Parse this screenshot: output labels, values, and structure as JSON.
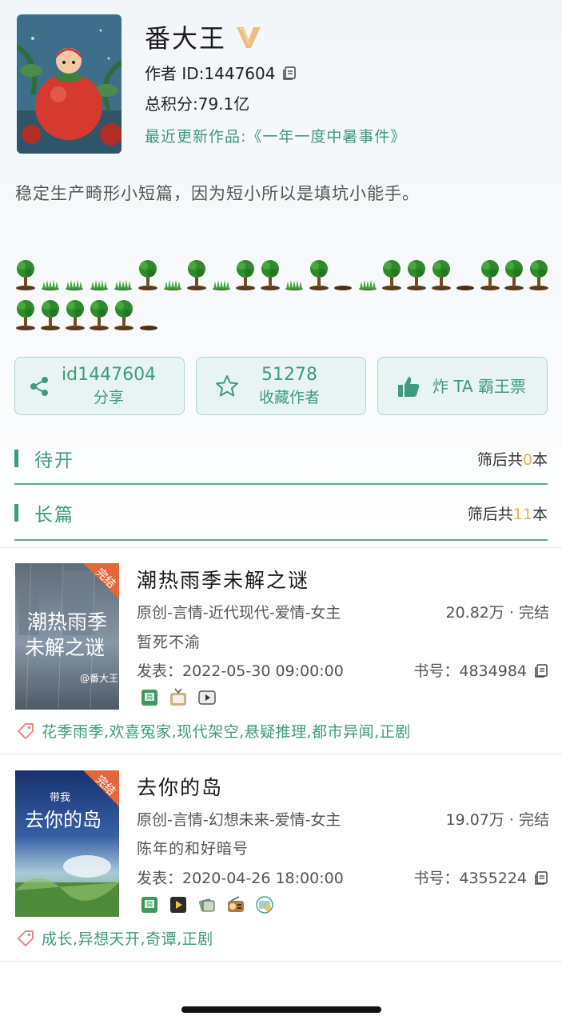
{
  "author": {
    "name": "番大王",
    "id_line": "作者 ID:1447604",
    "score_line": "总积分:79.1亿",
    "recent_line": "最近更新作品:《一年一度中暑事件》",
    "bio": "稳定生产畸形小短篇，因为短小所以是填坑小能手。"
  },
  "trees": {
    "row1": [
      "tree",
      "grass",
      "grass",
      "grass",
      "grass",
      "tree",
      "grass",
      "tree",
      "grass",
      "tree",
      "tree",
      "grass",
      "tree",
      "hole",
      "grass",
      "tree",
      "tree",
      "tree",
      "hole",
      "tree",
      "tree",
      "tree"
    ],
    "row2": [
      "tree",
      "tree",
      "tree",
      "tree",
      "tree",
      "hole"
    ]
  },
  "actions": {
    "share": {
      "main": "id1447604",
      "sub": "分享",
      "icon": "share-icon"
    },
    "favorite": {
      "main": "51278",
      "sub": "收藏作者",
      "icon": "star-icon"
    },
    "bomb": {
      "label": "炸 TA 霸王票",
      "icon": "thumbs-up-icon"
    }
  },
  "sections": {
    "pending": {
      "title": "待开",
      "count_prefix": "筛后共",
      "count": "0",
      "count_suffix": "本"
    },
    "long": {
      "title": "长篇",
      "count_prefix": "筛后共",
      "count": "11",
      "count_suffix": "本"
    }
  },
  "books": [
    {
      "title": "潮热雨季未解之谜",
      "category": "原创-言情-近代现代-爱情-女主",
      "stats": "20.82万 · 完结",
      "summary": "暂死不渝",
      "published": "发表：2022-05-30 09:00:00",
      "book_no": "书号：4834984",
      "tags": "花季雨季,欢喜冤家,现代架空,悬疑推理,都市异闻,正剧",
      "badge": "完结",
      "cover_text_1": "潮热雨季",
      "cover_text_2": "未解之谜",
      "cover_sign": "@番大王",
      "icons": [
        "book-icon",
        "tv-icon",
        "video-icon"
      ]
    },
    {
      "title": "去你的岛",
      "category": "原创-言情-幻想未来-爱情-女主",
      "stats": "19.07万 · 完结",
      "summary": "陈年的和好暗号",
      "published": "发表：2020-04-26 18:00:00",
      "book_no": "书号：4355224",
      "tags": "成长,异想天开,奇谭,正剧",
      "badge": "完结",
      "cover_text_1": "带我",
      "cover_text_2": "去你的岛",
      "icons": [
        "book-icon",
        "play-icon",
        "film-icon",
        "radio-icon",
        "comic-icon"
      ]
    }
  ],
  "colors": {
    "accent": "#3f9a7e",
    "count_highlight": "#e6b44a",
    "vip": "#e8b46a"
  }
}
